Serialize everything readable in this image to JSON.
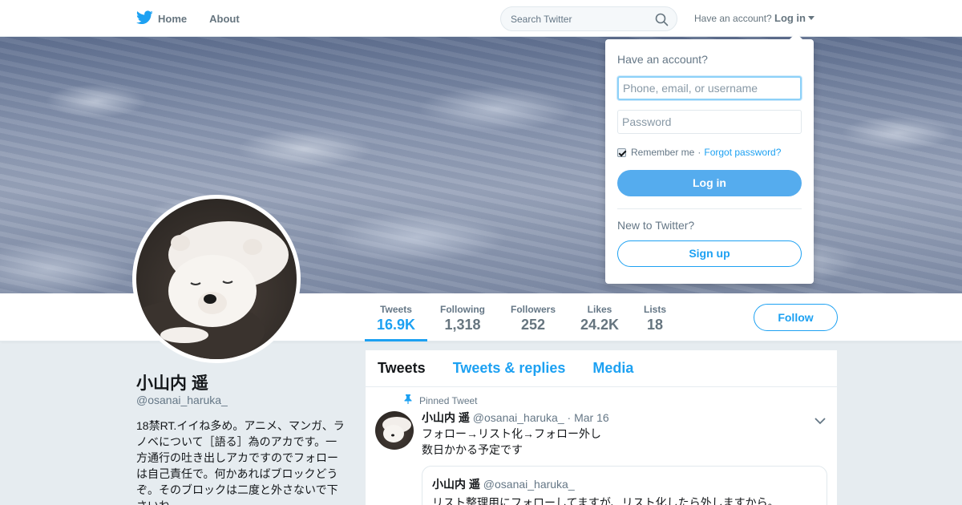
{
  "nav": {
    "home": "Home",
    "about": "About",
    "search_placeholder": "Search Twitter",
    "have_account": "Have an account?",
    "login": "Log in"
  },
  "profile": {
    "name": "小山内 遥",
    "handle": "@osanai_haruka_",
    "bio": "18禁RT.イイね多め。アニメ、マンガ、ラノベについて［語る］為のアカです。一方通行の吐き出しアカですのでフォローは自己責任で。何かあればブロックどうぞ。そのブロックは二度と外さないで下さいね。",
    "stats": [
      {
        "label": "Tweets",
        "value": "16.9K"
      },
      {
        "label": "Following",
        "value": "1,318"
      },
      {
        "label": "Followers",
        "value": "252"
      },
      {
        "label": "Likes",
        "value": "24.2K"
      },
      {
        "label": "Lists",
        "value": "18"
      }
    ],
    "follow": "Follow"
  },
  "tabs": [
    "Tweets",
    "Tweets & replies",
    "Media"
  ],
  "tweet": {
    "pinned": "Pinned Tweet",
    "name": "小山内 遥",
    "handle": "@osanai_haruka_",
    "date": "· Mar 16",
    "line1": "フォロー→リスト化→フォロー外し",
    "line2": "数日かかる予定です",
    "quote_name": "小山内 遥",
    "quote_handle": "@osanai_haruka_",
    "quote_text": "リスト整理用にフォローしてますが、リスト化したら外しますから。"
  },
  "login": {
    "title": "Have an account?",
    "user_placeholder": "Phone, email, or username",
    "password_placeholder": "Password",
    "remember": "Remember me",
    "forgot": "Forgot password?",
    "login_btn": "Log in",
    "new_to": "New to Twitter?",
    "signup": "Sign up"
  },
  "colors": {
    "accent": "#1da1f2",
    "login_button": "#55acee"
  }
}
